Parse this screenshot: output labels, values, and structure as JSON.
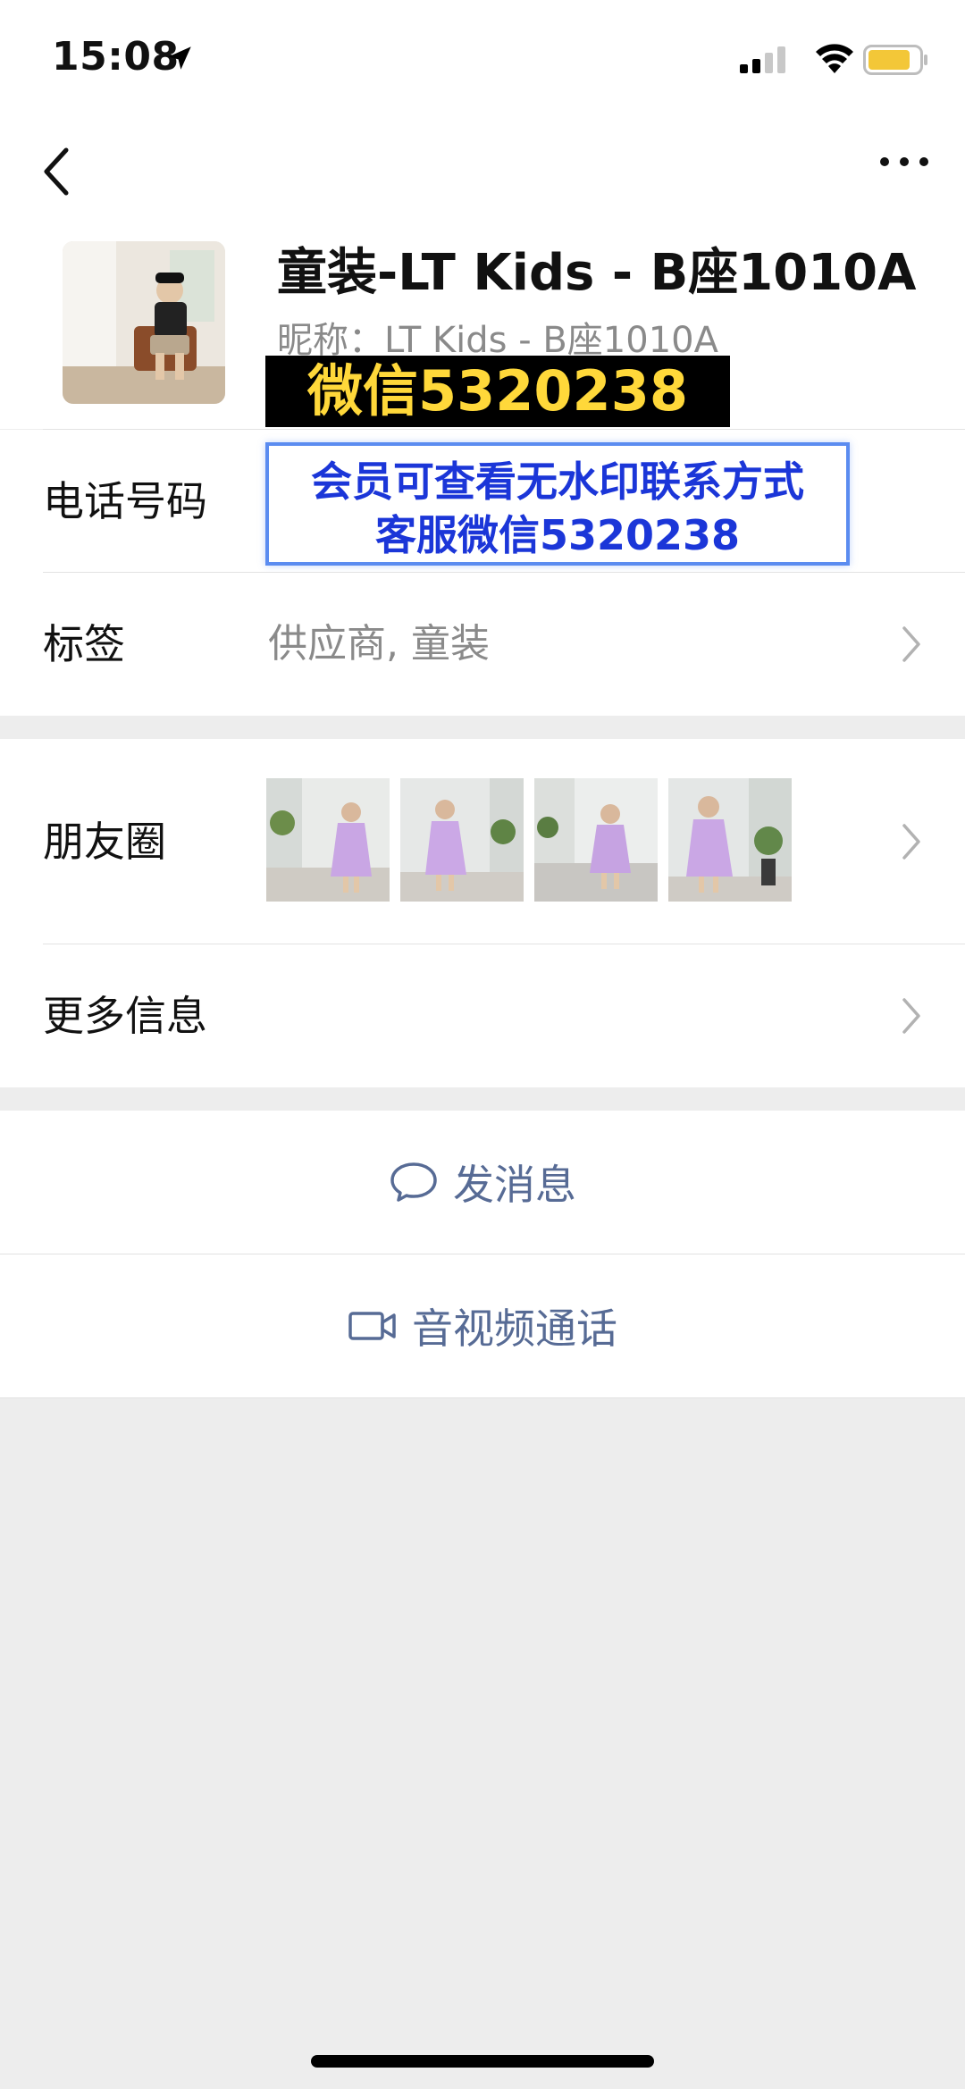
{
  "status_bar": {
    "time": "15:08"
  },
  "profile": {
    "name": "童装-LT Kids - B座1010A",
    "nickname": "昵称：LT Kids - B座1010A",
    "watermark": "微信5320238"
  },
  "rows": {
    "phone": {
      "label": "电话号码",
      "watermark_line1": "会员可查看无水印联系方式",
      "watermark_line2": "客服微信5320238"
    },
    "tags": {
      "label": "标签",
      "value": "供应商, 童装"
    },
    "moments": {
      "label": "朋友圈"
    },
    "more_info": {
      "label": "更多信息"
    }
  },
  "actions": {
    "message": "发消息",
    "video_call": "音视频通话"
  },
  "colors": {
    "link": "#576b95",
    "watermark_yellow": "#ffd83a",
    "watermark_blue": "#1b36d8"
  }
}
